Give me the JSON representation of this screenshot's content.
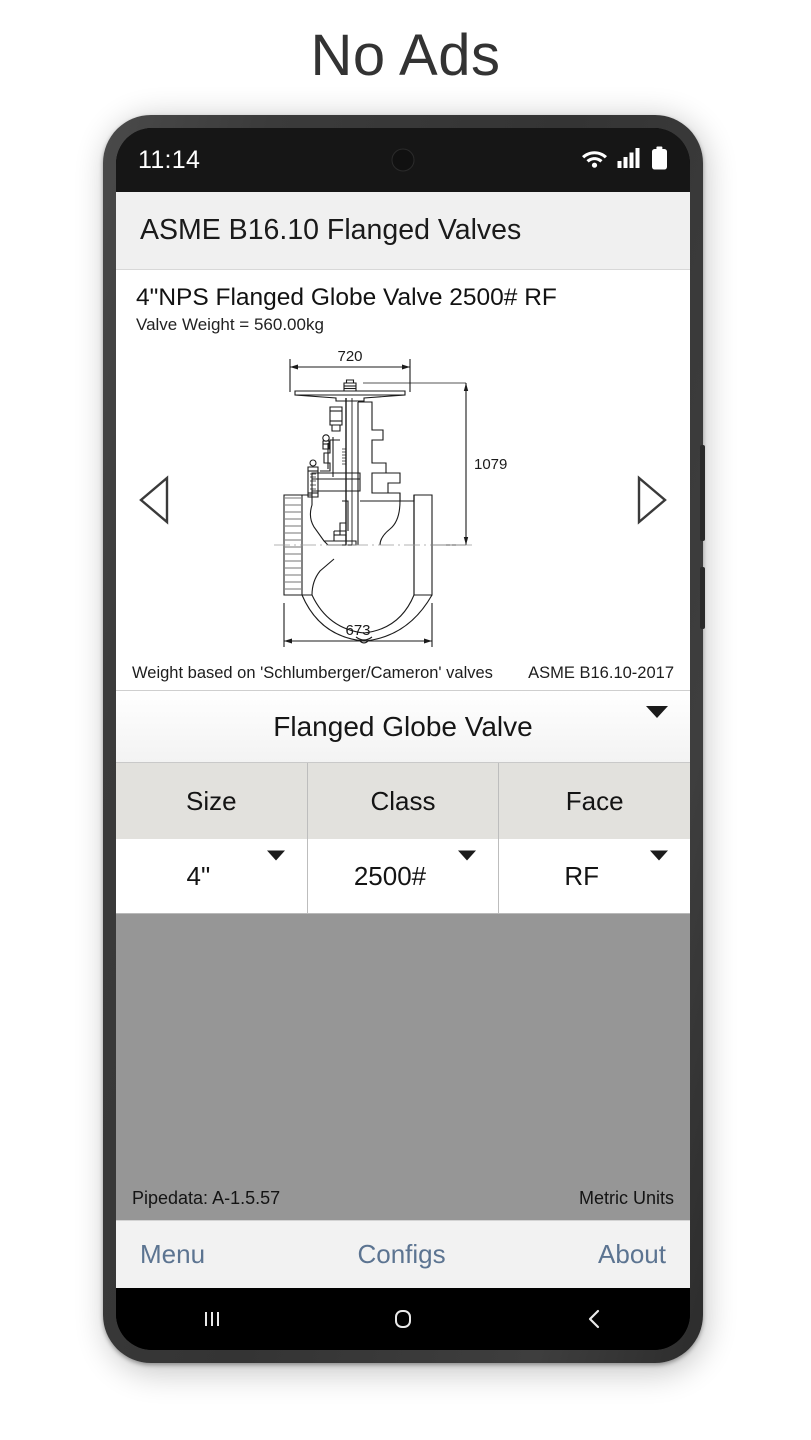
{
  "banner": {
    "headline": "No Ads"
  },
  "status_bar": {
    "time": "11:14",
    "icons": [
      "wifi-icon",
      "signal-icon",
      "battery-icon"
    ]
  },
  "app": {
    "title": "ASME B16.10 Flanged Valves",
    "card": {
      "title": "4\"NPS Flanged Globe Valve 2500# RF",
      "subtitle": "Valve Weight = 560.00kg",
      "prev_label": "previous",
      "next_label": "next",
      "footer_left": "Weight based on 'Schlumberger/Cameron' valves",
      "footer_right": "ASME B16.10-2017",
      "dimensions": {
        "width_top": "720",
        "height_overall": "1079",
        "length_face_to_face": "673"
      }
    },
    "type_selector": {
      "value": "Flanged Globe Valve",
      "caret": "chevron-down-icon"
    },
    "spec_table": {
      "headers": [
        "Size",
        "Class",
        "Face"
      ],
      "values": [
        "4\"",
        "2500#",
        "RF"
      ]
    },
    "status_strip": {
      "left": "Pipedata: A-1.5.57",
      "right": "Metric Units"
    },
    "bottom_nav": [
      {
        "label": "Menu"
      },
      {
        "label": "Configs"
      },
      {
        "label": "About"
      }
    ]
  },
  "system_nav": {
    "recents": "recents-icon",
    "home": "home-icon",
    "back": "back-icon"
  },
  "colors": {
    "accent_link": "#5c7491",
    "filler_gray": "#969696",
    "table_header": "#e2e1dd",
    "appbar": "#f0f0f0"
  }
}
